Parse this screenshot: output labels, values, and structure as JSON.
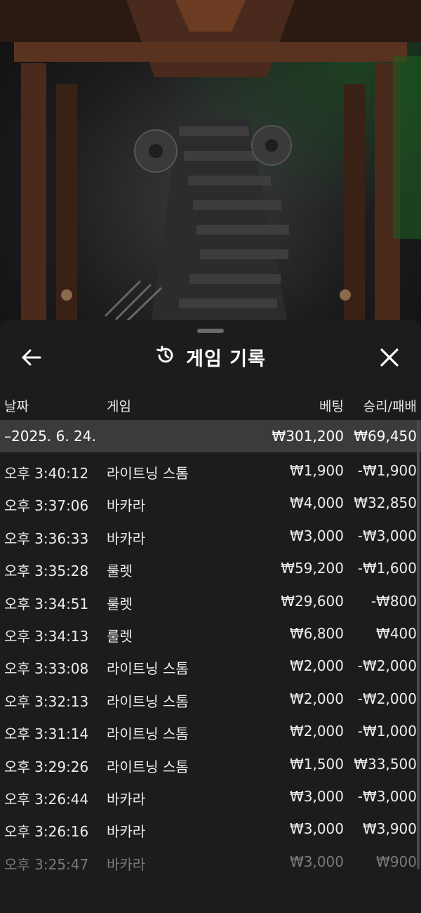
{
  "header": {
    "title": "게임 기록"
  },
  "columns": {
    "date": "날짜",
    "game": "게임",
    "bet": "베팅",
    "result": "승리/패배"
  },
  "summary": {
    "date": "–2025. 6. 24.",
    "total_bet": "₩301,200",
    "total_result": "₩69,450"
  },
  "rows": [
    {
      "time": "오후 3:40:12",
      "game": "라이트닝 스톰",
      "bet": "₩1,900",
      "result": "-₩1,900"
    },
    {
      "time": "오후 3:37:06",
      "game": "바카라",
      "bet": "₩4,000",
      "result": "₩32,850"
    },
    {
      "time": "오후 3:36:33",
      "game": "바카라",
      "bet": "₩3,000",
      "result": "-₩3,000"
    },
    {
      "time": "오후 3:35:28",
      "game": "룰렛",
      "bet": "₩59,200",
      "result": "-₩1,600"
    },
    {
      "time": "오후 3:34:51",
      "game": "룰렛",
      "bet": "₩29,600",
      "result": "-₩800"
    },
    {
      "time": "오후 3:34:13",
      "game": "룰렛",
      "bet": "₩6,800",
      "result": "₩400"
    },
    {
      "time": "오후 3:33:08",
      "game": "라이트닝 스톰",
      "bet": "₩2,000",
      "result": "-₩2,000"
    },
    {
      "time": "오후 3:32:13",
      "game": "라이트닝 스톰",
      "bet": "₩2,000",
      "result": "-₩2,000"
    },
    {
      "time": "오후 3:31:14",
      "game": "라이트닝 스톰",
      "bet": "₩2,000",
      "result": "-₩1,000"
    },
    {
      "time": "오후 3:29:26",
      "game": "라이트닝 스톰",
      "bet": "₩1,500",
      "result": "₩33,500"
    },
    {
      "time": "오후 3:26:44",
      "game": "바카라",
      "bet": "₩3,000",
      "result": "-₩3,000"
    },
    {
      "time": "오후 3:26:16",
      "game": "바카라",
      "bet": "₩3,000",
      "result": "₩3,900"
    },
    {
      "time": "오후 3:25:47",
      "game": "바카라",
      "bet": "₩3,000",
      "result": "₩900"
    }
  ],
  "icons": {
    "back": "arrow-left-icon",
    "history": "history-icon",
    "close": "close-icon"
  },
  "colors": {
    "sheet_bg": "#1c1c1c",
    "summary_bg": "#3b3b3b",
    "text": "#ffffff",
    "faded_text": "#7a7a7a"
  }
}
